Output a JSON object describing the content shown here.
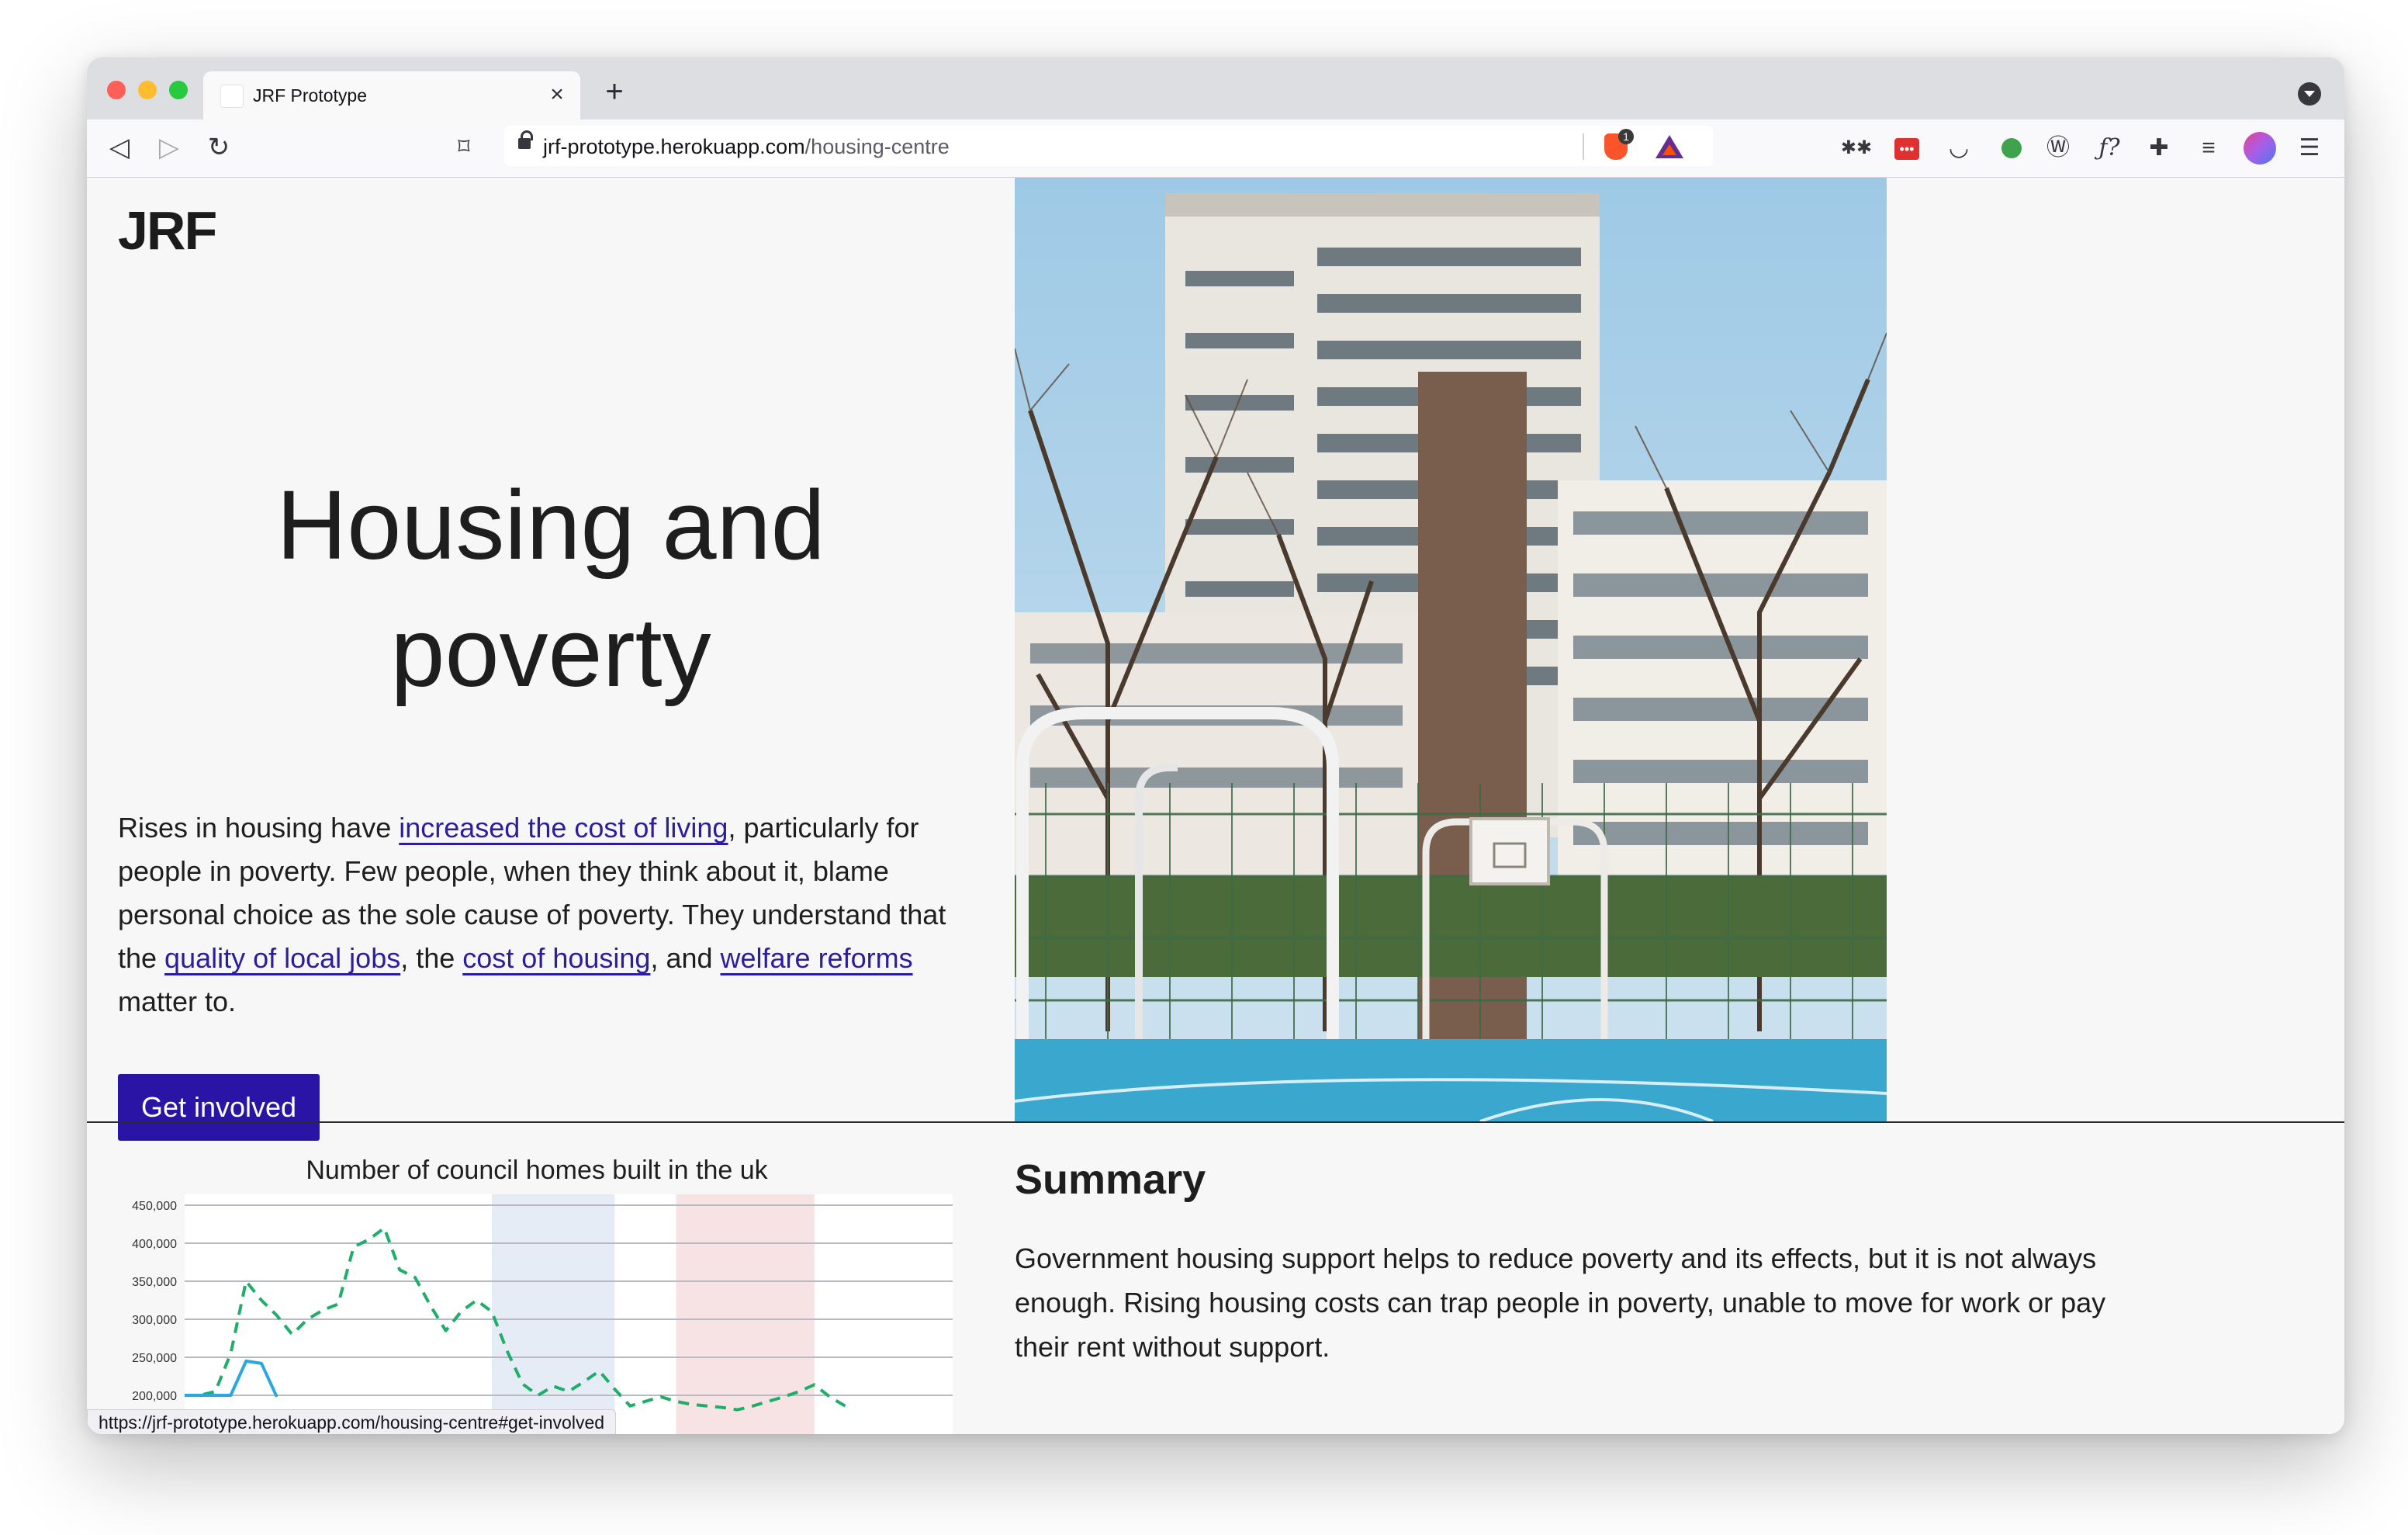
{
  "browser": {
    "tab_title": "JRF Prototype",
    "url_host": "jrf-prototype.herokuapp.com",
    "url_path": "/housing-centre",
    "shields_count": "1",
    "status_url": "https://jrf-prototype.herokuapp.com/housing-centre#get-involved"
  },
  "page": {
    "logo": "JRF",
    "hero_title_line1": "Housing and",
    "hero_title_line2": "poverty",
    "intro": {
      "t1": "Rises in housing have ",
      "link1": "increased the cost of living",
      "t2": ", particularly for people in poverty. Few people, when they think about it, blame personal choice as the sole cause of poverty. They understand that the ",
      "link2": "quality of local jobs",
      "t3": ", the ",
      "link3": "cost of housing",
      "t4": ", and ",
      "link4": "welfare reforms",
      "t5": " matter to."
    },
    "cta_label": "Get involved",
    "summary_title": "Summary",
    "summary_text": "Government housing support helps to reduce poverty and its effects, but it is not always enough. Rising housing costs can trap people in poverty, unable to move for work or pay their rent without support."
  },
  "colors": {
    "accent": "#2a14a6",
    "link": "#2c1d9e",
    "series_green": "#1fae6a",
    "series_blue": "#29a8df",
    "band_blue": "#e6ecf5",
    "band_red": "#f7e3e3"
  },
  "chart_data": {
    "type": "line",
    "title": "Number of council homes built in the uk",
    "yticks": [
      "450,000",
      "400,000",
      "350,000",
      "300,000",
      "250,000",
      "200,000"
    ],
    "ylim": [
      200000,
      450000
    ],
    "x": [
      0,
      1,
      2,
      3,
      4,
      5,
      6,
      7,
      8,
      9,
      10,
      11,
      12,
      13,
      14,
      15,
      16,
      17,
      18,
      19,
      20,
      21,
      22,
      23,
      24,
      25,
      26,
      27,
      28,
      29,
      30,
      31,
      32,
      33,
      34,
      35,
      36,
      37,
      38,
      39,
      40,
      41,
      42,
      43,
      44,
      45,
      46,
      47,
      48,
      49,
      50
    ],
    "series": [
      {
        "values": [
          200000,
          200000,
          205000,
          255000,
          350000,
          325000,
          305000,
          280000,
          300000,
          312000,
          320000,
          395000,
          405000,
          420000,
          365000,
          355000,
          318000,
          285000,
          310000,
          325000,
          310000,
          258000,
          215000,
          200000,
          212000,
          205000,
          218000,
          232000,
          208000,
          186000,
          192000,
          198000,
          192000,
          188000,
          186000,
          184000,
          181000,
          186000,
          192000,
          198000,
          205000,
          214000,
          198000,
          186000
        ],
        "style": "dashed"
      },
      {
        "values": [
          200000,
          200000,
          200000,
          200000,
          245000,
          242000,
          198000
        ],
        "style": "solid"
      }
    ],
    "bands": [
      {
        "from": 20,
        "to": 28,
        "color": "#e6ecf5"
      },
      {
        "from": 32,
        "to": 41,
        "color": "#f7e3e3"
      }
    ],
    "grid": true,
    "legend": "none"
  }
}
